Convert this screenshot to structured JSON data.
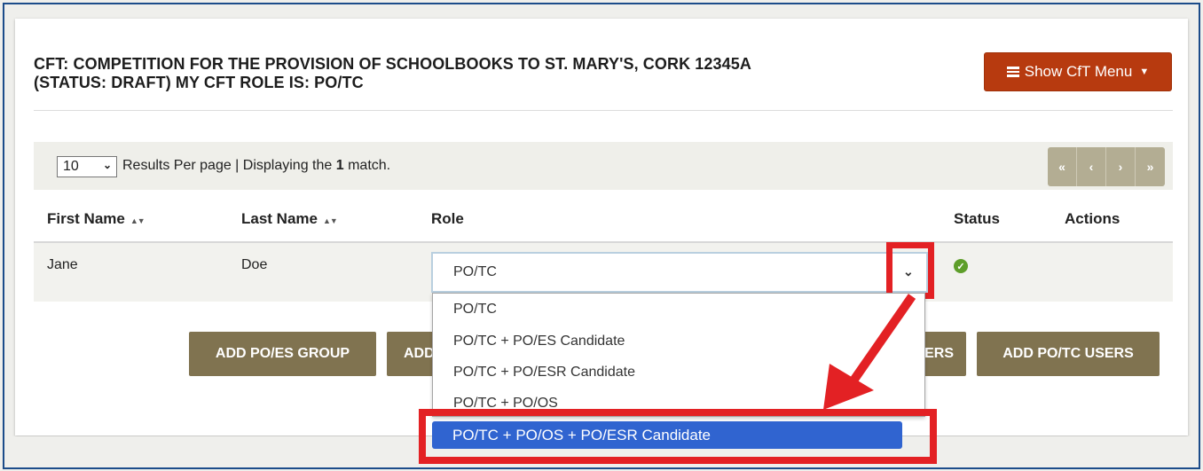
{
  "header": {
    "title_line1": "CFT: COMPETITION FOR THE PROVISION OF SCHOOLBOOKS TO ST. MARY'S, CORK 12345A",
    "title_line2": "(STATUS: DRAFT) MY CFT ROLE IS: PO/TC",
    "menu_button_label": "Show CfT Menu"
  },
  "toolbar": {
    "per_page_value": "10",
    "results_prefix": "Results Per page | Displaying the ",
    "results_count": "1",
    "results_suffix": " match.",
    "pager": [
      "«",
      "‹",
      "›",
      "»"
    ]
  },
  "table": {
    "columns": [
      "First Name",
      "Last Name",
      "Role",
      "Status",
      "Actions"
    ],
    "rows": [
      {
        "first_name": "Jane",
        "last_name": "Doe",
        "role": "PO/TC",
        "status": "active"
      }
    ]
  },
  "buttons": {
    "add_po_es_group": "ADD PO/ES GROUP",
    "add_hidden_left": "ADD",
    "add_hidden_right": "ERS",
    "add_po_tc_users": "ADD PO/TC USERS"
  },
  "dropdown": {
    "options": [
      "PO/TC",
      "PO/TC + PO/ES Candidate",
      "PO/TC + PO/ESR Candidate",
      "PO/TC + PO/OS",
      "PO/TC + PO/OS + PO/ESR Candidate"
    ],
    "selected": "PO/TC + PO/OS + PO/ESR Candidate"
  },
  "colors": {
    "menu_button": "#b73a0f",
    "action_button": "#807350",
    "pager": "#b3ad93",
    "highlight": "#e32124",
    "selected_option": "#3064d0",
    "status_ok": "#5e9e2a"
  }
}
